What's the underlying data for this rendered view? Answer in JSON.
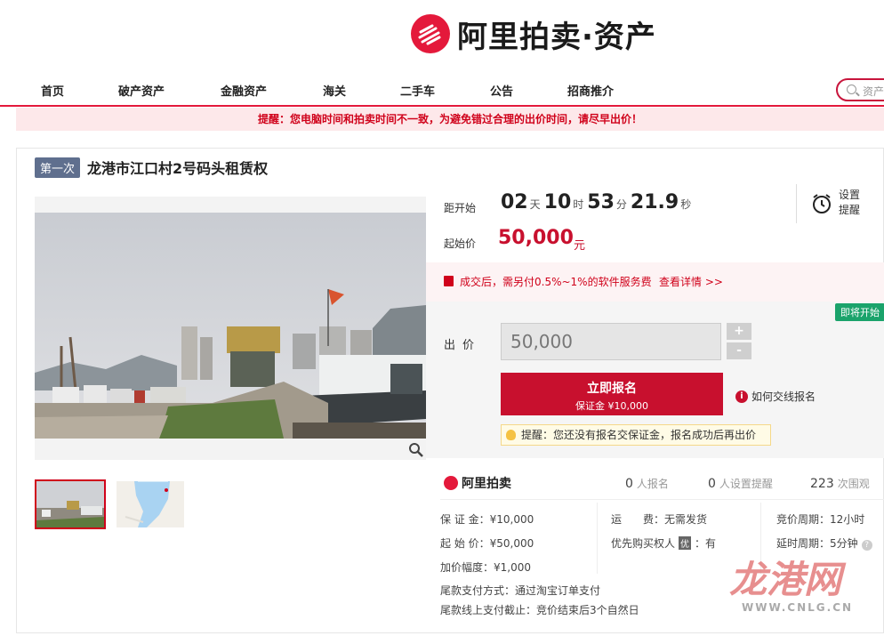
{
  "brand": {
    "name": "阿里拍卖·资产"
  },
  "nav": {
    "items": [
      "首页",
      "破产资产",
      "金融资产",
      "海关",
      "二手车",
      "公告",
      "招商推介"
    ],
    "search_placeholder": "资产"
  },
  "banner": {
    "text": "提醒：您电脑时间和拍卖时间不一致，为避免错过合理的出价时间，请尽早出价！"
  },
  "lot": {
    "round": "第一次",
    "title": "龙港市江口村2号码头租赁权"
  },
  "countdown": {
    "label": "距开始",
    "days": "02",
    "days_unit": "天",
    "hours": "10",
    "hours_unit": "时",
    "minutes": "53",
    "minutes_unit": "分",
    "seconds": "21.9",
    "seconds_unit": "秒"
  },
  "reminder": {
    "line1": "设置",
    "line2": "提醒"
  },
  "price": {
    "label": "起始价",
    "value": "50,000",
    "unit": "元"
  },
  "fee": {
    "text": "成交后，需另付0.5%~1%的软件服务费",
    "link": "查看详情 >>"
  },
  "bid": {
    "status_badge": "即将开始",
    "label": "出价",
    "amount": "50,000",
    "increment_symbol": "+",
    "decrement_symbol": "-",
    "signup_label": "立即报名",
    "deposit_label": "保证金 ¥10,000",
    "offline_help": "如何交线报名",
    "tip": "提醒：您还没有报名交保证金，报名成功后再出价"
  },
  "stats": {
    "brand": "阿里拍卖",
    "signups": "0",
    "signups_label": "人报名",
    "reminders": "0",
    "reminders_label": "人设置提醒",
    "views": "223",
    "views_label": "次围观"
  },
  "details": {
    "deposit_label": "保 证 金：",
    "deposit_value": "¥10,000",
    "start_price_label": "起 始 价：",
    "start_price_value": "¥50,000",
    "increment_label": "加价幅度：",
    "increment_value": "¥1,000",
    "shipping_label": "运　　费：",
    "shipping_value": "无需发货",
    "priority_label": "优先购买权人",
    "priority_badge": "优",
    "priority_value": "：有",
    "cycle_label": "竞价周期：",
    "cycle_value": "12小时",
    "delay_label": "延时周期：",
    "delay_value": "5分钟",
    "payment_method_label": "尾款支付方式：",
    "payment_method_value": "通过淘宝订单支付",
    "payment_deadline_label": "尾款线上支付截止：",
    "payment_deadline_value": "竞价结束后3个自然日"
  },
  "watermark": {
    "cn": "龙港网",
    "en": "WWW.CNLG.CN"
  },
  "colors": {
    "accent": "#c8102e",
    "brand": "#e4193b",
    "badge_green": "#1aa36b"
  }
}
